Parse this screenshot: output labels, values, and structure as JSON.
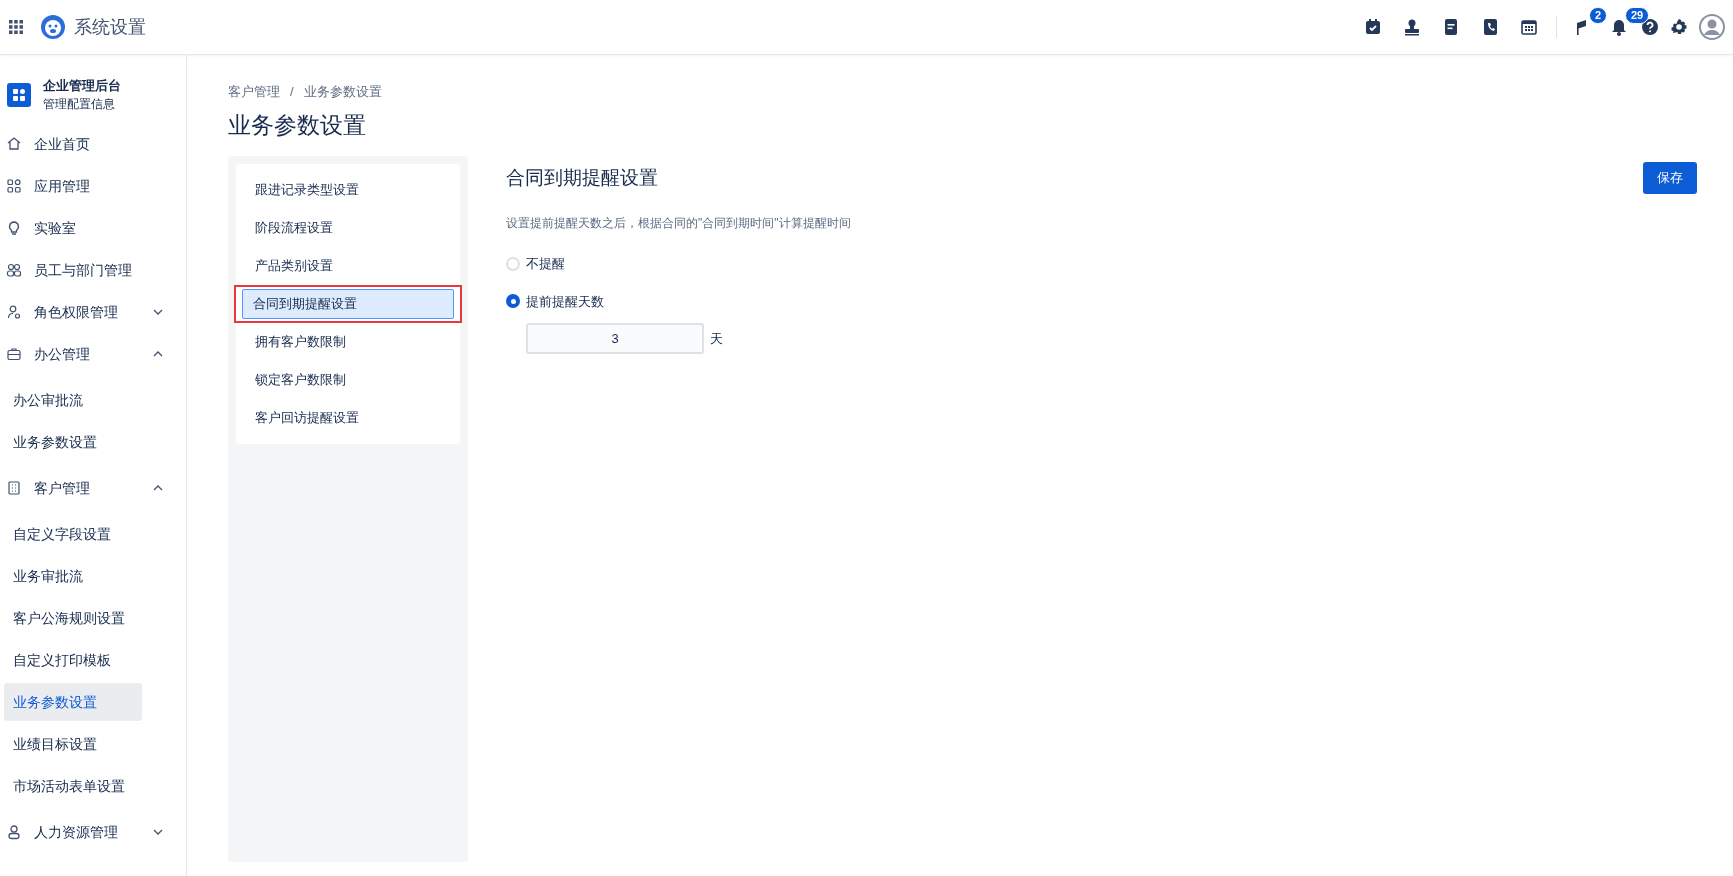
{
  "header": {
    "title": "系统设置",
    "badges": [
      {
        "count": "2"
      },
      {
        "count": "29"
      }
    ]
  },
  "sidebar": {
    "org_name": "企业管理后台",
    "org_subtitle": "管理配置信息",
    "items": [
      {
        "label": "企业首页"
      },
      {
        "label": "应用管理"
      },
      {
        "label": "实验室"
      },
      {
        "label": "员工与部门管理"
      },
      {
        "label": "角色权限管理",
        "expanded": false
      },
      {
        "label": "办公管理",
        "expanded": true,
        "children": [
          {
            "label": "办公审批流",
            "selected": false
          },
          {
            "label": "业务参数设置",
            "selected": false
          }
        ]
      },
      {
        "label": "客户管理",
        "expanded": true,
        "children": [
          {
            "label": "自定义字段设置",
            "selected": false
          },
          {
            "label": "业务审批流",
            "selected": false
          },
          {
            "label": "客户公海规则设置",
            "selected": false
          },
          {
            "label": "自定义打印模板",
            "selected": false
          },
          {
            "label": "业务参数设置",
            "selected": true
          },
          {
            "label": "业绩目标设置",
            "selected": false
          },
          {
            "label": "市场活动表单设置",
            "selected": false
          }
        ]
      },
      {
        "label": "人力资源管理",
        "expanded": false
      }
    ]
  },
  "breadcrumb": {
    "items": [
      "客户管理",
      "业务参数设置"
    ],
    "separator": "/"
  },
  "page_title": "业务参数设置",
  "settings_menu": [
    {
      "label": "跟进记录类型设置",
      "selected": false,
      "highlighted": false
    },
    {
      "label": "阶段流程设置",
      "selected": false,
      "highlighted": false
    },
    {
      "label": "产品类别设置",
      "selected": false,
      "highlighted": false
    },
    {
      "label": "合同到期提醒设置",
      "selected": true,
      "highlighted": true
    },
    {
      "label": "拥有客户数限制",
      "selected": false,
      "highlighted": false
    },
    {
      "label": "锁定客户数限制",
      "selected": false,
      "highlighted": false
    },
    {
      "label": "客户回访提醒设置",
      "selected": false,
      "highlighted": false
    }
  ],
  "panel": {
    "title": "合同到期提醒设置",
    "save_button": "保存",
    "description": "设置提前提醒天数之后，根据合同的\"合同到期时间\"计算提醒时间",
    "options": [
      {
        "label": "不提醒",
        "selected": false
      },
      {
        "label": "提前提醒天数",
        "selected": true
      }
    ],
    "days_value": "3",
    "days_unit": "天"
  }
}
